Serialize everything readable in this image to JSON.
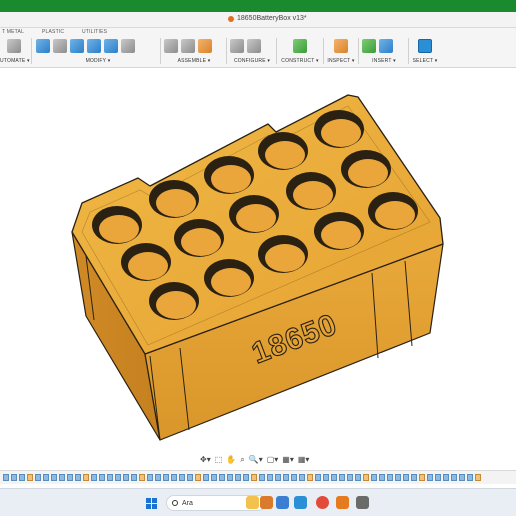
{
  "window": {
    "document_title": "18650BatteryBox v13*",
    "title_icon": "fusion-file-icon"
  },
  "toolbar": {
    "tabs": [
      {
        "label": "T METAL"
      },
      {
        "label": "PLASTIC"
      },
      {
        "label": "UTILITIES"
      }
    ],
    "groups": [
      {
        "label": "UTOMATE ▾"
      },
      {
        "label": "MODIFY ▾"
      },
      {
        "label": "ASSEMBLE ▾"
      },
      {
        "label": "CONFIGURE ▾"
      },
      {
        "label": "CONSTRUCT ▾"
      },
      {
        "label": "INSPECT ▾"
      },
      {
        "label": "INSERT ▾"
      },
      {
        "label": "SELECT ▾"
      }
    ]
  },
  "model": {
    "engraved_text": "18650",
    "body_color": "#e8a83a",
    "edge_color": "#2a2113",
    "holes": 15
  },
  "navbar": {
    "items": [
      "✥▾",
      "⬚",
      "✋",
      "⌕",
      "🔍▾",
      "▢▾",
      "▦▾",
      "▦▾"
    ]
  },
  "taskbar": {
    "search_placeholder": "Ara"
  }
}
